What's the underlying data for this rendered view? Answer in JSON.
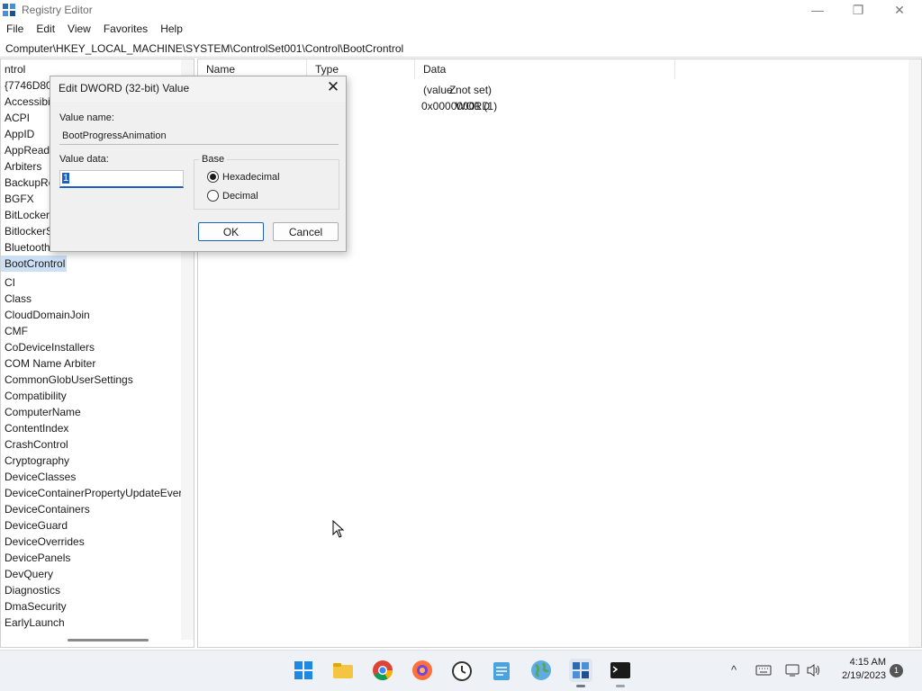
{
  "window": {
    "title": "Registry Editor",
    "controls": {
      "minimize": "—",
      "maximize": "❐",
      "close": "✕"
    }
  },
  "menu": [
    "File",
    "Edit",
    "View",
    "Favorites",
    "Help"
  ],
  "address": "Computer\\HKEY_LOCAL_MACHINE\\SYSTEM\\ControlSet001\\Control\\BootCrontrol",
  "tree": {
    "items": [
      "ntrol",
      "{7746D80F",
      "Accessibil",
      "ACPI",
      "AppID",
      "AppReadi",
      "Arbiters",
      "BackupRe",
      "BGFX",
      "BitLocker",
      "BitlockerS",
      "Bluetooth",
      "BootCrontrol",
      "CI",
      "Class",
      "CloudDomainJoin",
      "CMF",
      "CoDeviceInstallers",
      "COM Name Arbiter",
      "CommonGlobUserSettings",
      "Compatibility",
      "ComputerName",
      "ContentIndex",
      "CrashControl",
      "Cryptography",
      "DeviceClasses",
      "DeviceContainerPropertyUpdateEver",
      "DeviceContainers",
      "DeviceGuard",
      "DeviceOverrides",
      "DevicePanels",
      "DevQuery",
      "Diagnostics",
      "DmaSecurity",
      "EarlyLaunch"
    ],
    "selected_index": 12
  },
  "list": {
    "columns": {
      "name": "Name",
      "type": "Type",
      "data": "Data"
    },
    "rows": [
      {
        "name": "",
        "type": "Z",
        "data": "(value not set)"
      },
      {
        "name": "",
        "type": "WORD",
        "data": "0x00000001 (1)"
      }
    ]
  },
  "dialog": {
    "title": "Edit DWORD (32-bit) Value",
    "close": "✕",
    "value_name_label": "Value name:",
    "value_name": "BootProgressAnimation",
    "value_data_label": "Value data:",
    "value_data": "1",
    "base_label": "Base",
    "hex_label": "Hexadecimal",
    "dec_label": "Decimal",
    "base_selected": "Hexadecimal",
    "ok": "OK",
    "cancel": "Cancel"
  },
  "taskbar": {
    "time": "4:15 AM",
    "date": "2/19/2023",
    "notifications": "1",
    "tray_chevron": "^",
    "icons": [
      "windows-start-icon",
      "file-explorer-icon",
      "chrome-icon",
      "firefox-icon",
      "clock-app-icon",
      "notepad-icon",
      "earth-icon",
      "registry-editor-icon",
      "terminal-icon"
    ]
  }
}
